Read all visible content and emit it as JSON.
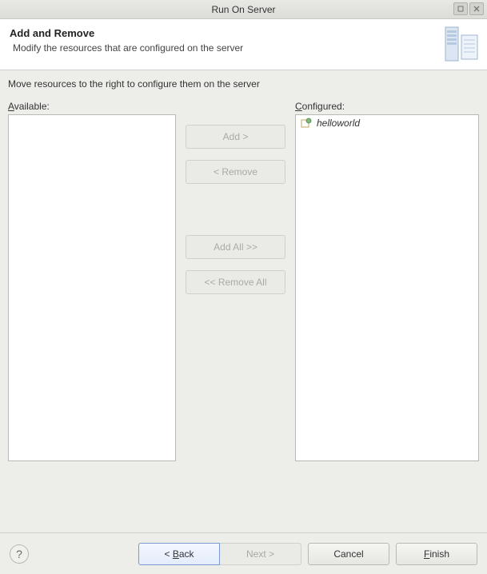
{
  "window": {
    "title": "Run On Server"
  },
  "header": {
    "title": "Add and Remove",
    "description": "Modify the resources that are configured on the server"
  },
  "instruction": "Move resources to the right to configure them on the server",
  "labels": {
    "available": "vailable:",
    "available_mn": "A",
    "configured": "onfigured:",
    "configured_mn": "C"
  },
  "buttons": {
    "add": "Add >",
    "remove": "< Remove",
    "addAll": "Add All >>",
    "removeAll": "<< Remove All",
    "back": "ack",
    "back_mn": "B",
    "back_prefix": "< ",
    "next": "Next >",
    "cancel": "Cancel",
    "finish": "inish",
    "finish_mn": "F"
  },
  "available_items": [],
  "configured_items": [
    {
      "label": "helloworld"
    }
  ]
}
